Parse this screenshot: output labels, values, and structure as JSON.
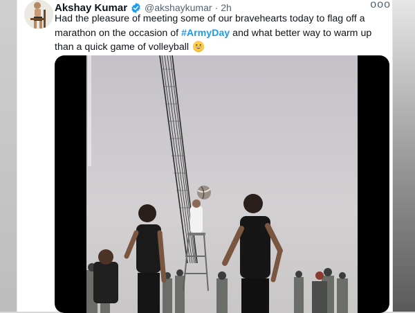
{
  "tweet": {
    "author_name": "Akshay Kumar",
    "handle": "@akshaykumar",
    "separator": "·",
    "time": "2h",
    "more_label": "ooo",
    "text_part1": "Had the pleasure of meeting some of our bravehearts today to flag off a marathon on the occasion of ",
    "hashtag": "#ArmyDay",
    "text_part2": " and what better way to warm up than a quick game of volleyball",
    "emoji_icon": "grinning-face-emoji-icon",
    "verified_icon": "verified-badge-icon"
  },
  "colors": {
    "hashtag": "#1d9bf0",
    "verified": "#1d9bf0",
    "text": "#0f1419",
    "secondary": "#536471"
  }
}
